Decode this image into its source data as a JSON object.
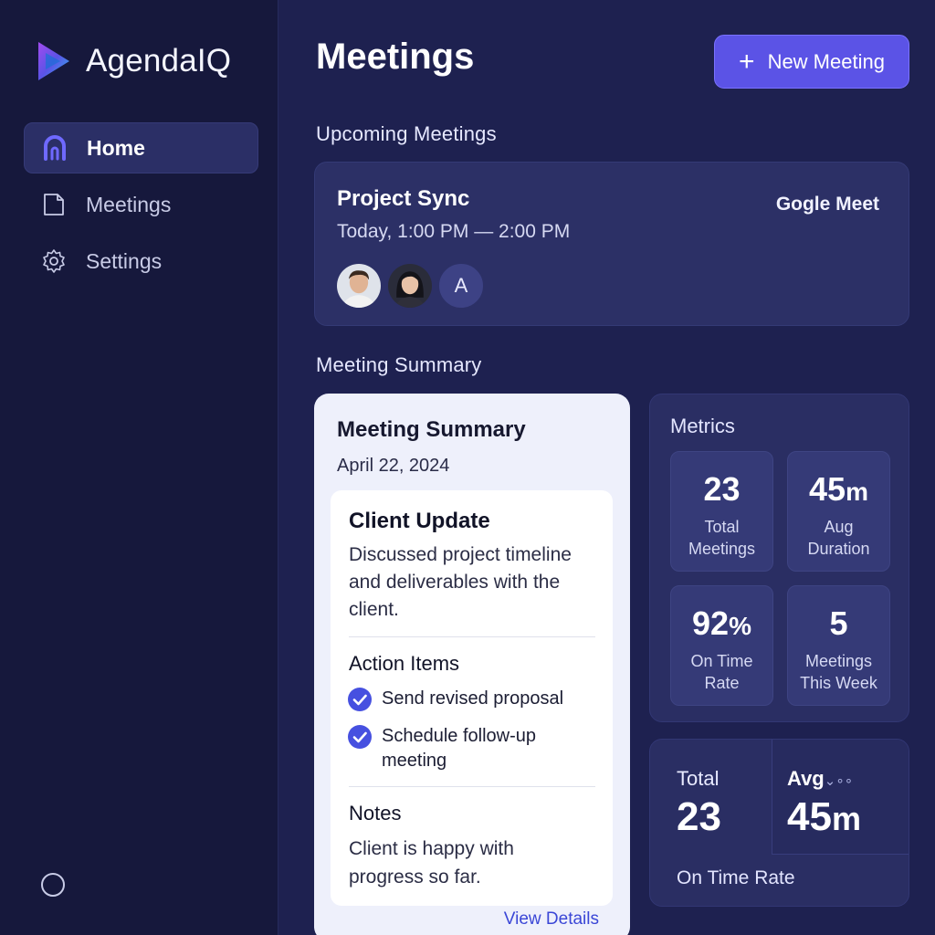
{
  "app": {
    "name": "AgendaIQ"
  },
  "sidebar": {
    "items": [
      {
        "label": "Home",
        "icon": "home-icon",
        "active": true
      },
      {
        "label": "Meetings",
        "icon": "document-icon",
        "active": false
      },
      {
        "label": "Settings",
        "icon": "gear-icon",
        "active": false
      }
    ]
  },
  "header": {
    "title": "Meetings",
    "new_button_label": "New Meeting"
  },
  "upcoming": {
    "section_title": "Upcoming Meetings",
    "meeting": {
      "title": "Project Sync",
      "time": "Today, 1:00 PM — 2:00 PM",
      "platform": "Gogle Meet",
      "attendees": [
        {
          "type": "photo",
          "name": "man-avatar"
        },
        {
          "type": "photo",
          "name": "woman-avatar"
        },
        {
          "type": "initial",
          "initial": "A"
        }
      ]
    }
  },
  "summary": {
    "section_title": "Meeting Summary",
    "card_title": "Meeting Summary",
    "date": "April 22, 2024",
    "client_title": "Client Update",
    "client_desc": "Discussed project timeline and deliverables with the client.",
    "action_items_title": "Action Items",
    "action_items": [
      "Send revised proposal",
      "Schedule follow-up meeting"
    ],
    "notes_title": "Notes",
    "notes_text": "Client is happy with progress so far.",
    "view_details_label": "View Details"
  },
  "metrics": {
    "title": "Metrics",
    "tiles": [
      {
        "value": "23",
        "unit": "",
        "label_line1": "Total",
        "label_line2": "Meetings"
      },
      {
        "value": "45",
        "unit": "m",
        "label_line1": "Aug",
        "label_line2": "Duration"
      },
      {
        "value": "92",
        "unit": "%",
        "label_line1": "On Time",
        "label_line2": "Rate"
      },
      {
        "value": "5",
        "unit": "",
        "label_line1": "Meetings",
        "label_line2": "This Week"
      }
    ]
  },
  "bottom_card": {
    "total_label": "Total",
    "total_value": "23",
    "avg_label": "Avg",
    "avg_dots": "⌄∘∘",
    "avg_value": "45",
    "avg_unit": "m",
    "footer_label": "On Time Rate"
  },
  "colors": {
    "background": "#1e2150",
    "sidebar": "#16183c",
    "accent": "#5b53e6",
    "card": "#2c3066",
    "check": "#4650e0"
  }
}
